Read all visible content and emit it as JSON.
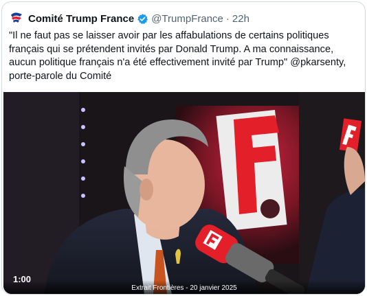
{
  "tweet": {
    "author_name": "Comité Trump France",
    "handle": "@TrumpFrance",
    "separator": "·",
    "time": "22h",
    "text": "\"Il ne faut pas se laisser avoir par les affabulations de certains politiques\nfrançais qui se prétendent invités par Donald Trump. A ma connaissance,\naucun politique français n'a été effectivement invité par Trump\" @pkarsenty,\nporte-parole du Comité",
    "icons": {
      "avatar": "avatar-flag-icon",
      "verified": "verified-badge-icon"
    }
  },
  "media": {
    "duration": "1:00",
    "caption": "Extrait Frontières - 20 janvier 2025",
    "backdrop_logo_letter": "F",
    "backdrop_vertical_word": "FRONTIÈRES",
    "mic_logo_letter": "F",
    "corner_logo_letter": "F",
    "colors": {
      "brand_red": "#e3202a",
      "background": "#161316"
    }
  }
}
